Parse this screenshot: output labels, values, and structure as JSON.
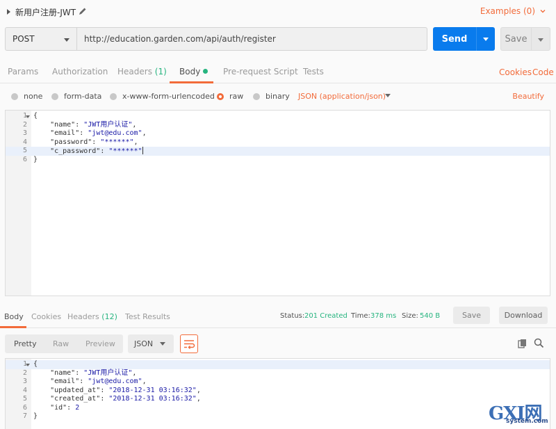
{
  "request": {
    "name": "新用户注册-JWT",
    "examples_label": "Examples (0)",
    "method": "POST",
    "url": "http://education.garden.com/api/auth/register",
    "send_label": "Send",
    "save_label": "Save"
  },
  "request_tabs": {
    "params": "Params",
    "authorization": "Authorization",
    "headers": "Headers",
    "headers_count": "(1)",
    "body": "Body",
    "prerequest": "Pre-request Script",
    "tests": "Tests",
    "cookies": "Cookies",
    "code": "Code"
  },
  "body_types": {
    "none": "none",
    "form_data": "form-data",
    "urlencoded": "x-www-form-urlencoded",
    "raw": "raw",
    "binary": "binary",
    "selected": "raw",
    "content_type": "JSON (application/json)",
    "beautify": "Beautify"
  },
  "request_body": {
    "highlighted_line": 5,
    "lines": [
      {
        "n": "1",
        "text": "{"
      },
      {
        "n": "2",
        "key": "    \"name\"",
        "val": "\"JWT用户认证\"",
        "end": ","
      },
      {
        "n": "3",
        "key": "    \"email\"",
        "val": "\"jwt@edu.com\"",
        "end": ","
      },
      {
        "n": "4",
        "key": "    \"password\"",
        "val": "\"******\"",
        "end": ","
      },
      {
        "n": "5",
        "key": "    \"c_password\"",
        "val": "\"******\"",
        "end": ""
      },
      {
        "n": "6",
        "text": "}"
      }
    ]
  },
  "response_tabs": {
    "body": "Body",
    "cookies": "Cookies",
    "headers": "Headers",
    "headers_count": "(12)",
    "test_results": "Test Results"
  },
  "response_meta": {
    "status_label": "Status:",
    "status_value": "201 Created",
    "time_label": "Time:",
    "time_value": "378 ms",
    "size_label": "Size:",
    "size_value": "540 B",
    "save_label": "Save",
    "download_label": "Download"
  },
  "response_format": {
    "pretty": "Pretty",
    "raw": "Raw",
    "preview": "Preview",
    "language": "JSON"
  },
  "response_body": {
    "lines": [
      {
        "n": "1",
        "text": "{"
      },
      {
        "n": "2",
        "key": "    \"name\"",
        "val": "\"JWT用户认证\"",
        "end": ","
      },
      {
        "n": "3",
        "key": "    \"email\"",
        "val": "\"jwt@edu.com\"",
        "end": ","
      },
      {
        "n": "4",
        "key": "    \"updated_at\"",
        "val": "\"2018-12-31 03:16:32\"",
        "end": ","
      },
      {
        "n": "5",
        "key": "    \"created_at\"",
        "val": "\"2018-12-31 03:16:32\"",
        "end": ","
      },
      {
        "n": "6",
        "key": "    \"id\"",
        "val": "2",
        "end": ""
      },
      {
        "n": "7",
        "text": "}"
      }
    ]
  },
  "watermark": {
    "brand": "GXI网",
    "domain": "system.com"
  },
  "colors": {
    "accent": "#f26b3a",
    "primary": "#097bed",
    "success": "#26b47f",
    "string": "#1a1aa6"
  }
}
